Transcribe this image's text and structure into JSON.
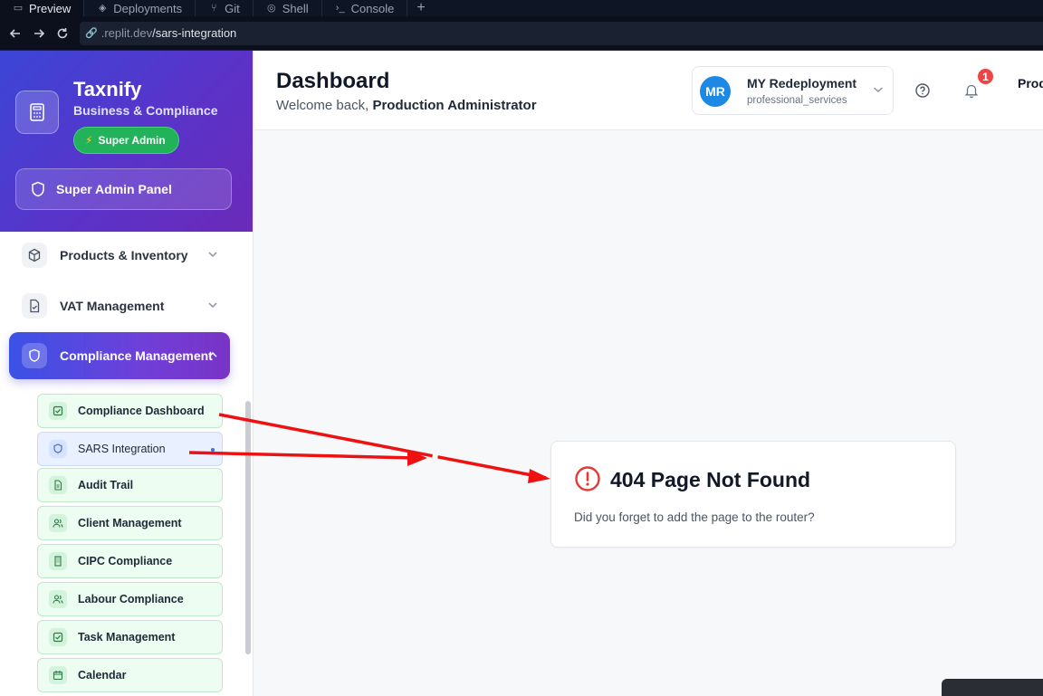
{
  "browser": {
    "tabs": [
      {
        "label": "Preview",
        "icon": "monitor-icon",
        "active": true
      },
      {
        "label": "Deployments",
        "icon": "deploy-icon",
        "active": false
      },
      {
        "label": "Git",
        "icon": "git-icon",
        "active": false
      },
      {
        "label": "Shell",
        "icon": "shell-icon",
        "active": false
      },
      {
        "label": "Console",
        "icon": "console-icon",
        "active": false
      }
    ],
    "add_tab": "+",
    "url_host": ".replit.dev",
    "url_path": "/sars-integration"
  },
  "brand": {
    "title": "Taxnify",
    "subtitle": "Business & Compliance",
    "badge": "Super Admin",
    "panel_button": "Super Admin Panel"
  },
  "nav": {
    "items": [
      {
        "label": "Products & Inventory",
        "icon": "package-icon"
      },
      {
        "label": "VAT Management",
        "icon": "file-check-icon"
      },
      {
        "label": "Compliance Management",
        "icon": "shield-icon",
        "active": true
      }
    ],
    "sub_items": [
      {
        "label": "Compliance Dashboard",
        "icon": "checkbox-icon"
      },
      {
        "label": "SARS Integration",
        "icon": "shield-icon",
        "active": true
      },
      {
        "label": "Audit Trail",
        "icon": "document-icon"
      },
      {
        "label": "Client Management",
        "icon": "users-icon"
      },
      {
        "label": "CIPC Compliance",
        "icon": "building-icon"
      },
      {
        "label": "Labour Compliance",
        "icon": "users-icon"
      },
      {
        "label": "Task Management",
        "icon": "checkbox-icon"
      },
      {
        "label": "Calendar",
        "icon": "calendar-icon"
      }
    ]
  },
  "header": {
    "title": "Dashboard",
    "welcome_prefix": "Welcome back, ",
    "welcome_name": "Production Administrator",
    "company_initials": "MR",
    "company_name": "MY Redeployment",
    "company_type": "professional_services",
    "notification_count": "1",
    "user_truncated": "Prod"
  },
  "error": {
    "title": "404 Page Not Found",
    "message": "Did you forget to add the page to the router?"
  },
  "colors": {
    "brand_gradient_start": "#3b46d6",
    "brand_gradient_end": "#6b2ab9",
    "active_nav": "#5a46e0",
    "annotation_arrow": "#ee1111",
    "error_icon": "#e53935"
  }
}
